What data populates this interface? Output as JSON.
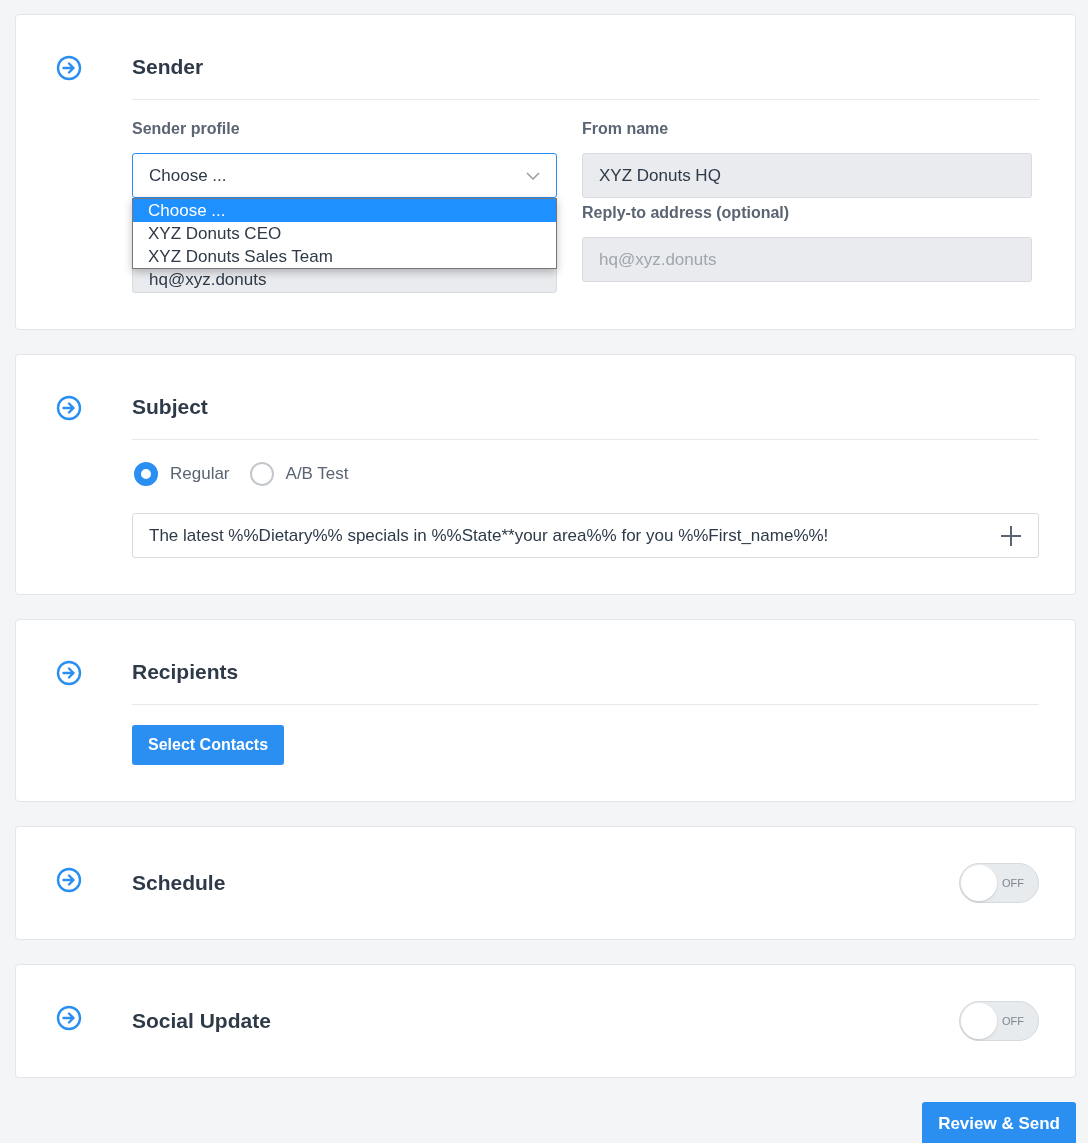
{
  "sections": [
    {
      "kind": "sender",
      "title": "Sender",
      "left": {
        "label": "Sender profile",
        "select": {
          "value": "Choose ...",
          "expanded": true,
          "options": [
            {
              "label": "Choose ...",
              "selected": true
            },
            {
              "label": "XYZ Donuts CEO",
              "selected": false
            },
            {
              "label": "XYZ Donuts Sales Team",
              "selected": false
            }
          ]
        },
        "covered_value": "hq@xyz.donuts"
      },
      "right": [
        {
          "label": "From name",
          "value": "XYZ Donuts HQ"
        },
        {
          "label": "Reply-to address (optional)",
          "placeholder": "hq@xyz.donuts"
        }
      ]
    },
    {
      "kind": "subject",
      "title": "Subject",
      "radios": [
        {
          "label": "Regular",
          "selected": true
        },
        {
          "label": "A/B Test",
          "selected": false
        }
      ],
      "value": "The latest %%Dietary%% specials in %%State**your area%% for you %%First_name%%!"
    },
    {
      "kind": "recipients",
      "title": "Recipients",
      "button": "Select Contacts"
    },
    {
      "kind": "toggle",
      "title": "Schedule",
      "toggle": {
        "on": false,
        "label": "OFF"
      }
    },
    {
      "kind": "toggle",
      "title": "Social Update",
      "toggle": {
        "on": false,
        "label": "OFF"
      }
    }
  ],
  "primary_button": "Review & Send"
}
